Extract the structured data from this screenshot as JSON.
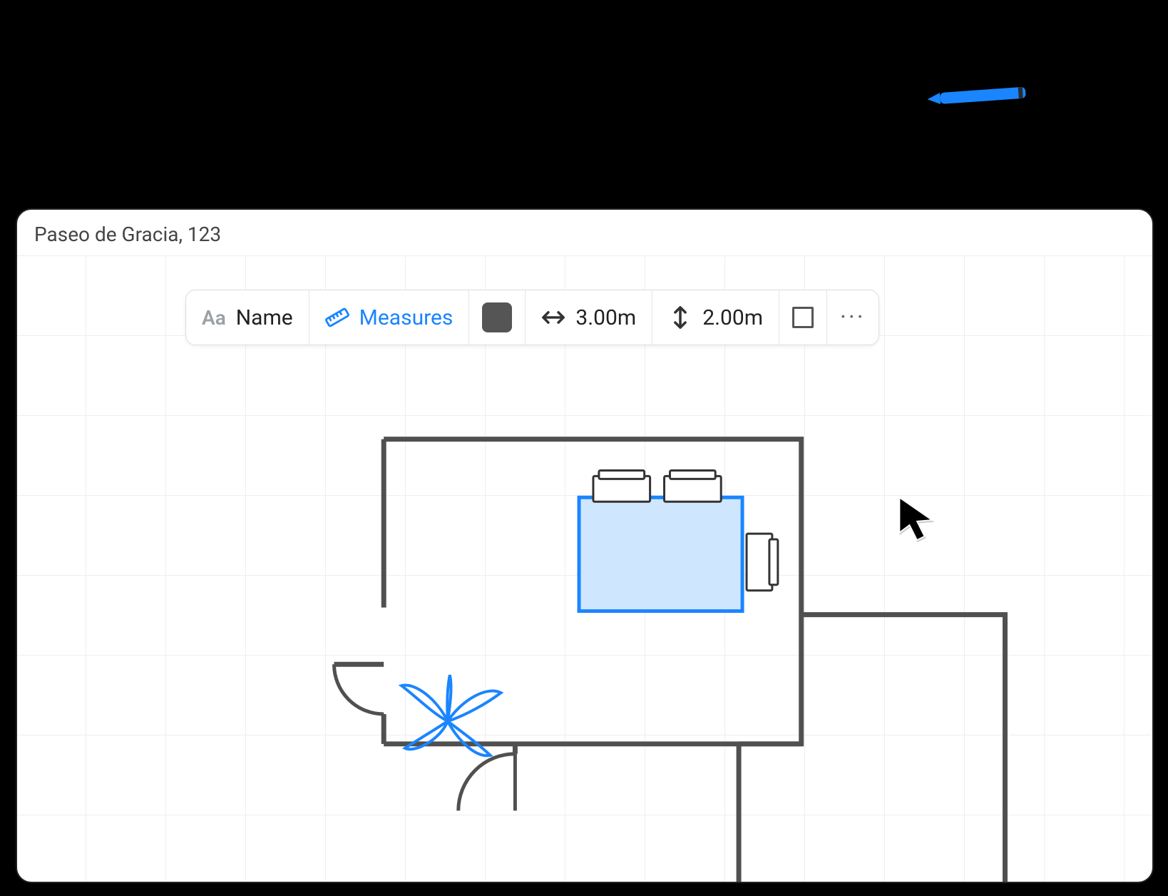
{
  "window": {
    "title": "Paseo de Gracia, 123"
  },
  "toolbar": {
    "name_label": "Name",
    "measures_label": "Measures",
    "width_value": "3.00m",
    "height_value": "2.00m",
    "swatch_color": "#555555"
  }
}
